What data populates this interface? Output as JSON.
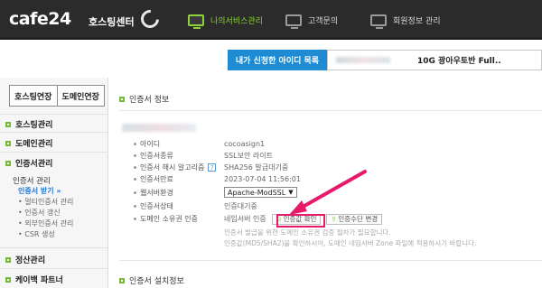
{
  "header": {
    "logo": "cafe24",
    "logo_sub": "호스팅센터",
    "nav": [
      {
        "label": "나의서비스관리",
        "active": true
      },
      {
        "label": "고객문의",
        "active": false
      },
      {
        "label": "회원정보 관리",
        "active": false
      }
    ]
  },
  "id_banner": {
    "label": "내가 신청한 아이디 목록",
    "product": "10G 광아우토반 Full.."
  },
  "sidebar": {
    "buttons": [
      "호스팅연장",
      "도메인연장"
    ],
    "sections": [
      {
        "label": "호스팅관리"
      },
      {
        "label": "도메인관리"
      },
      {
        "label": "인증서관리"
      }
    ],
    "sub_title": "인증서 관리",
    "sub_items": [
      {
        "label": "인증서 받기 »",
        "active": true
      },
      {
        "label": "• 멀티인증서 관리",
        "active": false
      },
      {
        "label": "• 인증서 갱신",
        "active": false
      },
      {
        "label": "• 외부인증서 관리",
        "active": false
      },
      {
        "label": "• CSR 생성",
        "active": false
      }
    ],
    "sections_bottom": [
      {
        "label": "정산관리"
      },
      {
        "label": "케이백 파트너"
      }
    ]
  },
  "main": {
    "cert_info_title": "인증서 정보",
    "cert_install_title": "인증서 설치정보",
    "rows": [
      {
        "key": "아이디",
        "value": "cocoasign1"
      },
      {
        "key": "인증서종류",
        "value": "SSL보안 라이트"
      },
      {
        "key": "인증서 해시 알고리즘",
        "help": "?",
        "value": "SHA256 발급대기중"
      },
      {
        "key": "인증서만료",
        "value": "2023-07-04 11:56:01"
      },
      {
        "key": "웹서버환경",
        "value": "Apache-ModSSL"
      },
      {
        "key": "인증서상태",
        "value": "인증대기중"
      },
      {
        "key": "도메인 소유권 인증",
        "value": "네임서버 인증"
      }
    ],
    "verify_button": "인증값 확인",
    "change_method_button": "인증수단 변경",
    "notes": [
      "인증서 발급을 위한 도메인 소유권 검증 절차가 필요합니다.",
      "인증값(MD5/SHA2)을 확인하시어, 도메인 네임서버 Zone 파일에 적용하시기 바랍니다."
    ]
  },
  "colors": {
    "header_bg": "#2b2b2b",
    "nav_active": "#8ed23c",
    "banner_blue": "#1f8bd2",
    "accent_green": "#79b93a",
    "highlight_pink": "#e6196a",
    "link_blue": "#1f7ad8"
  }
}
